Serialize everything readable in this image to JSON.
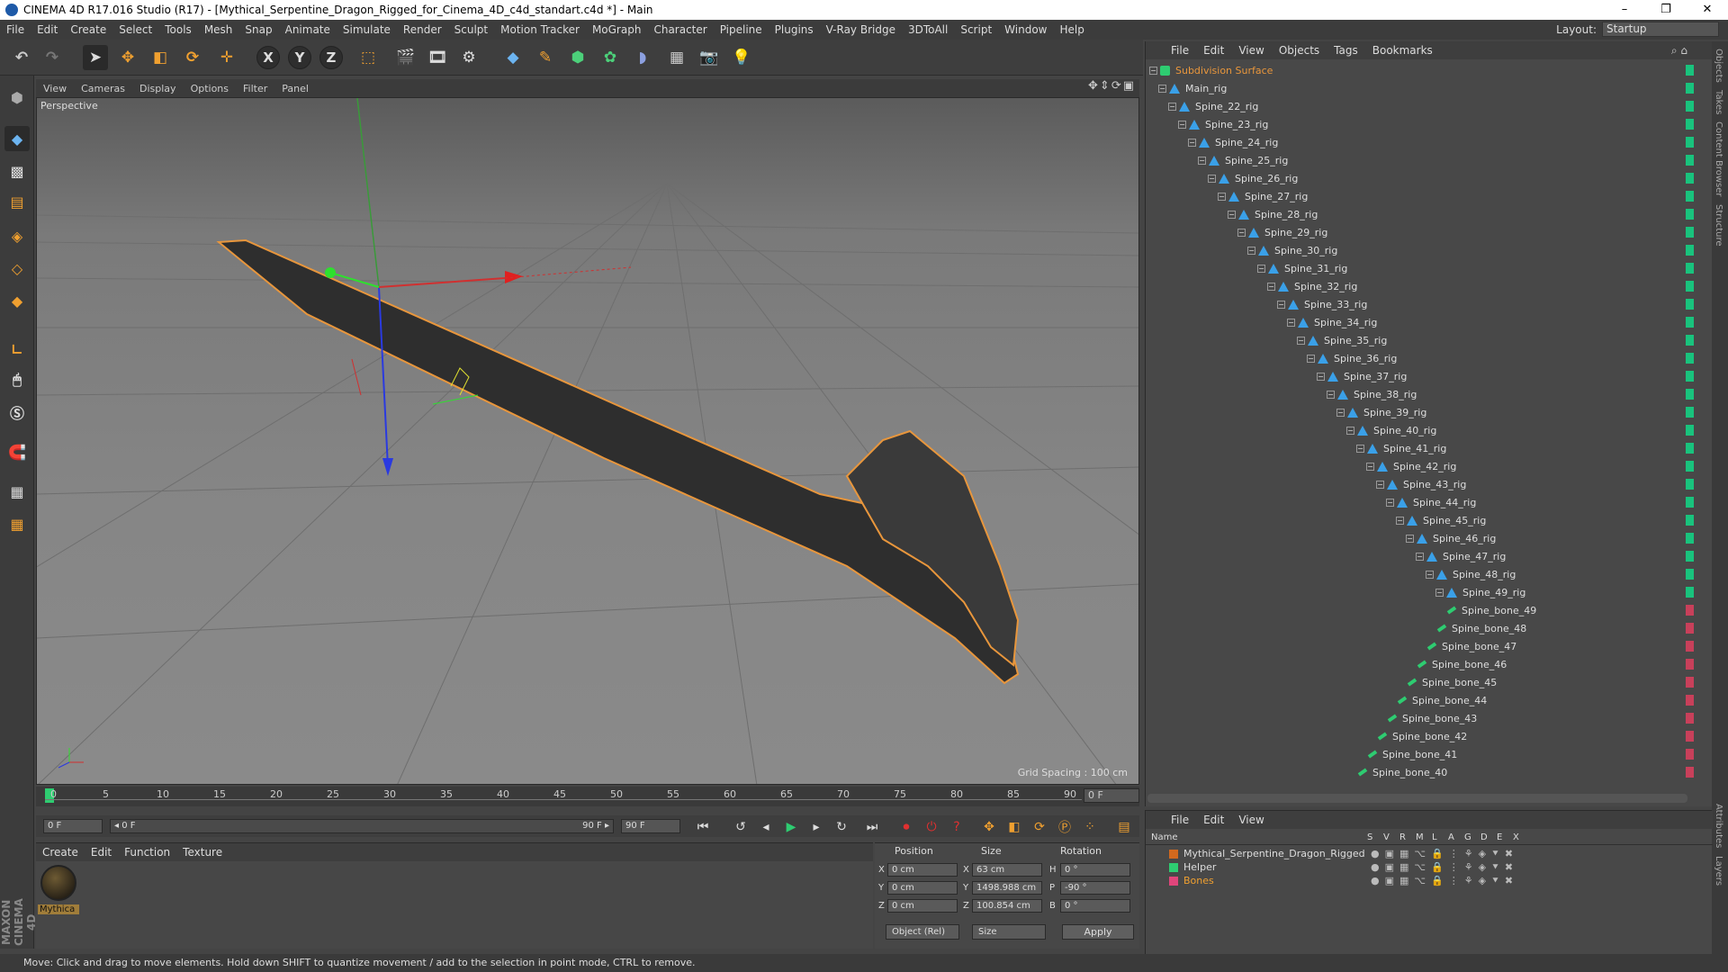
{
  "window": {
    "title": "CINEMA 4D R17.016 Studio (R17) - [Mythical_Serpentine_Dragon_Rigged_for_Cinema_4D_c4d_standart.c4d *] - Main",
    "minimize": "–",
    "maximize": "❐",
    "close": "✕"
  },
  "menu": [
    "File",
    "Edit",
    "Create",
    "Select",
    "Tools",
    "Mesh",
    "Snap",
    "Animate",
    "Simulate",
    "Render",
    "Sculpt",
    "Motion Tracker",
    "MoGraph",
    "Character",
    "Pipeline",
    "Plugins",
    "V-Ray Bridge",
    "3DToAll",
    "Script",
    "Window",
    "Help"
  ],
  "layout": {
    "label": "Layout:",
    "value": "Startup"
  },
  "toolbar": {
    "axis_x": "X",
    "axis_y": "Y",
    "axis_z": "Z"
  },
  "viewport": {
    "menu": [
      "View",
      "Cameras",
      "Display",
      "Options",
      "Filter",
      "Panel"
    ],
    "camera_label": "Perspective",
    "grid_spacing": "Grid Spacing : 100 cm"
  },
  "timeline": {
    "ticks": [
      "0",
      "5",
      "10",
      "15",
      "20",
      "25",
      "30",
      "35",
      "40",
      "45",
      "50",
      "55",
      "60",
      "65",
      "70",
      "75",
      "80",
      "85",
      "90"
    ],
    "current_frame": "0 F",
    "start_field": "0 F",
    "range_start": "◂ 0 F",
    "range_end": "90 F ▸",
    "end_field": "90 F"
  },
  "material_manager": {
    "menu": [
      "Create",
      "Edit",
      "Function",
      "Texture"
    ],
    "material_name": "Mythica"
  },
  "coordinates": {
    "headers": {
      "position": "Position",
      "size": "Size",
      "rotation": "Rotation"
    },
    "rows": [
      {
        "axis": "X",
        "position": "0 cm",
        "size_axis": "X",
        "size": "63 cm",
        "rot_axis": "H",
        "rotation": "0 °"
      },
      {
        "axis": "Y",
        "position": "0 cm",
        "size_axis": "Y",
        "size": "1498.988 cm",
        "rot_axis": "P",
        "rotation": "-90 °"
      },
      {
        "axis": "Z",
        "position": "0 cm",
        "size_axis": "Z",
        "size": "100.854 cm",
        "rot_axis": "B",
        "rotation": "0 °"
      }
    ],
    "mode": "Object (Rel)",
    "size_mode": "Size",
    "apply": "Apply"
  },
  "status": "Move: Click and drag to move elements. Hold down SHIFT to quantize movement / add to the selection in point mode, CTRL to remove.",
  "object_manager": {
    "menu": [
      "File",
      "Edit",
      "View",
      "Objects",
      "Tags",
      "Bookmarks"
    ],
    "rows": [
      {
        "name": "Subdivision Surface",
        "kind": "subdiv"
      },
      {
        "name": "Main_rig",
        "kind": "null"
      },
      {
        "name": "Spine_22_rig",
        "kind": "null"
      },
      {
        "name": "Spine_23_rig",
        "kind": "null"
      },
      {
        "name": "Spine_24_rig",
        "kind": "null"
      },
      {
        "name": "Spine_25_rig",
        "kind": "null"
      },
      {
        "name": "Spine_26_rig",
        "kind": "null"
      },
      {
        "name": "Spine_27_rig",
        "kind": "null"
      },
      {
        "name": "Spine_28_rig",
        "kind": "null"
      },
      {
        "name": "Spine_29_rig",
        "kind": "null"
      },
      {
        "name": "Spine_30_rig",
        "kind": "null"
      },
      {
        "name": "Spine_31_rig",
        "kind": "null"
      },
      {
        "name": "Spine_32_rig",
        "kind": "null"
      },
      {
        "name": "Spine_33_rig",
        "kind": "null"
      },
      {
        "name": "Spine_34_rig",
        "kind": "null"
      },
      {
        "name": "Spine_35_rig",
        "kind": "null"
      },
      {
        "name": "Spine_36_rig",
        "kind": "null"
      },
      {
        "name": "Spine_37_rig",
        "kind": "null"
      },
      {
        "name": "Spine_38_rig",
        "kind": "null"
      },
      {
        "name": "Spine_39_rig",
        "kind": "null"
      },
      {
        "name": "Spine_40_rig",
        "kind": "null"
      },
      {
        "name": "Spine_41_rig",
        "kind": "null"
      },
      {
        "name": "Spine_42_rig",
        "kind": "null"
      },
      {
        "name": "Spine_43_rig",
        "kind": "null"
      },
      {
        "name": "Spine_44_rig",
        "kind": "null"
      },
      {
        "name": "Spine_45_rig",
        "kind": "null"
      },
      {
        "name": "Spine_46_rig",
        "kind": "null"
      },
      {
        "name": "Spine_47_rig",
        "kind": "null"
      },
      {
        "name": "Spine_48_rig",
        "kind": "null"
      },
      {
        "name": "Spine_49_rig",
        "kind": "null"
      },
      {
        "name": "Spine_bone_49",
        "kind": "bone"
      },
      {
        "name": "Spine_bone_48",
        "kind": "bone"
      },
      {
        "name": "Spine_bone_47",
        "kind": "bone"
      },
      {
        "name": "Spine_bone_46",
        "kind": "bone"
      },
      {
        "name": "Spine_bone_45",
        "kind": "bone"
      },
      {
        "name": "Spine_bone_44",
        "kind": "bone"
      },
      {
        "name": "Spine_bone_43",
        "kind": "bone"
      },
      {
        "name": "Spine_bone_42",
        "kind": "bone"
      },
      {
        "name": "Spine_bone_41",
        "kind": "bone"
      },
      {
        "name": "Spine_bone_40",
        "kind": "bone"
      }
    ]
  },
  "layer_manager": {
    "menu": [
      "File",
      "Edit",
      "View"
    ],
    "columns": [
      "Name",
      "S",
      "V",
      "R",
      "M",
      "L",
      "A",
      "G",
      "D",
      "E",
      "X"
    ],
    "layers": [
      {
        "name": "Mythical_Serpentine_Dragon_Rigged",
        "color": "#d2691e"
      },
      {
        "name": "Helper",
        "color": "#2ecc71"
      },
      {
        "name": "Bones",
        "color": "#e0457b"
      }
    ]
  },
  "side_tabs": [
    "Objects",
    "Takes",
    "Content Browser",
    "Structure",
    "Attributes",
    "Layers"
  ],
  "colors": {
    "accent_orange": "#e8963c",
    "null_blue": "#3aa0e8",
    "bone_green": "#2ecc71",
    "swatch_green": "#19c37d",
    "swatch_red": "#c8405a"
  }
}
